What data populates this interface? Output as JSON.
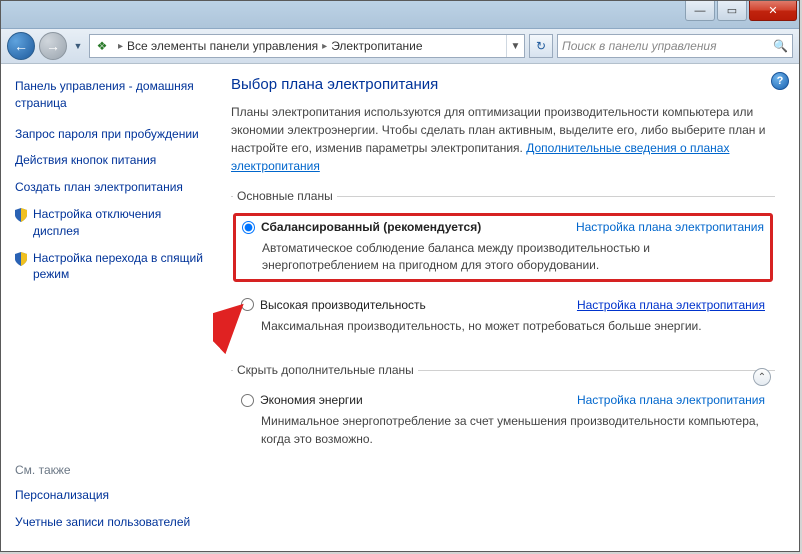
{
  "window": {
    "min_label": "—",
    "max_label": "▭",
    "close_label": "✕"
  },
  "nav": {
    "back_glyph": "←",
    "fwd_glyph": "→",
    "drop_glyph": "▼",
    "icon_glyph": "❖",
    "breadcrumb": {
      "part1": "Все элементы панели управления",
      "part2": "Электропитание",
      "sep": "▸"
    },
    "refresh_glyph": "↻",
    "search_placeholder": "Поиск в панели управления",
    "search_glyph": "🔍"
  },
  "sidebar": {
    "home": "Панель управления - домашняя страница",
    "links": [
      "Запрос пароля при пробуждении",
      "Действия кнопок питания",
      "Создать план электропитания"
    ],
    "shielded_links": [
      "Настройка отключения дисплея",
      "Настройка перехода в спящий режим"
    ],
    "see_also_label": "См. также",
    "see_also": [
      "Персонализация",
      "Учетные записи пользователей"
    ]
  },
  "content": {
    "help_glyph": "?",
    "title": "Выбор плана электропитания",
    "intro_text": "Планы электропитания используются для оптимизации производительности компьютера или экономии электроэнергии. Чтобы сделать план активным, выделите его, либо выберите план и настройте его, изменив параметры электропитания. ",
    "intro_link": "Дополнительные сведения о планах электропитания",
    "legend_main": "Основные планы",
    "legend_extra": "Скрыть дополнительные планы",
    "collapse_glyph": "⌃",
    "plans": [
      {
        "name": "Сбалансированный (рекомендуется)",
        "link": "Настройка плана электропитания",
        "desc": "Автоматическое соблюдение баланса между производительностью и энергопотреблением на пригодном для этого оборудовании."
      },
      {
        "name": "Высокая производительность",
        "link": "Настройка плана электропитания",
        "desc": "Максимальная производительность, но может потребоваться больше энергии."
      },
      {
        "name": "Экономия энергии",
        "link": "Настройка плана электропитания",
        "desc": "Минимальное энергопотребление за счет уменьшения производительности компьютера, когда это возможно."
      }
    ]
  }
}
